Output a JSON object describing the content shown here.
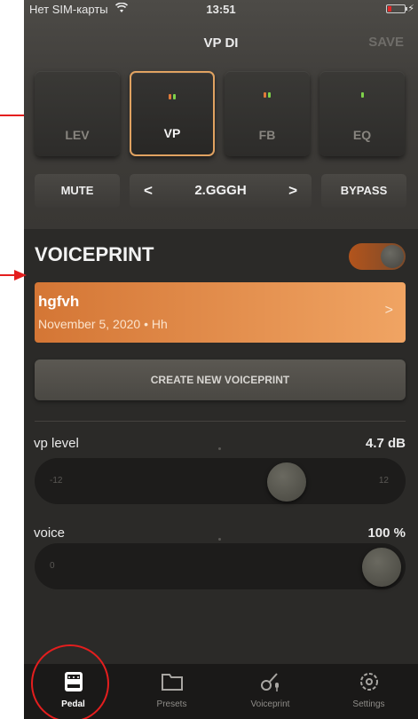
{
  "status_bar": {
    "carrier": "Нет SIM-карты",
    "time": "13:51",
    "wifi_icon": "wifi-icon",
    "battery_icon": "battery-low-icon",
    "charging_icon": "bolt-icon"
  },
  "nav": {
    "title": "VP DI",
    "save_label": "SAVE"
  },
  "blocks": [
    {
      "label": "LEV",
      "leds": [],
      "active": false
    },
    {
      "label": "VP",
      "leds": [
        "orange",
        "green"
      ],
      "active": true
    },
    {
      "label": "FB",
      "leds": [
        "orange",
        "green"
      ],
      "active": false
    },
    {
      "label": "EQ",
      "leds": [
        "green"
      ],
      "active": false
    }
  ],
  "controls": {
    "mute_label": "MUTE",
    "preset_name": "2.GGGH",
    "prev_icon": "chevron-left-icon",
    "next_icon": "chevron-right-icon",
    "bypass_label": "BYPASS"
  },
  "voiceprint": {
    "title": "VOICEPRINT",
    "toggle_on": true,
    "card": {
      "name": "hgfvh",
      "date": "November 5, 2020 • Hh"
    },
    "create_label": "CREATE NEW VOICEPRINT"
  },
  "params": [
    {
      "label": "vp level",
      "value": "4.7 dB",
      "min": "-12",
      "max": "12",
      "position": 0.705
    },
    {
      "label": "voice",
      "value": "100 %",
      "min": "0",
      "max": "",
      "position": 1.0
    }
  ],
  "tabs": [
    {
      "label": "Pedal",
      "icon": "pedal-icon",
      "active": true
    },
    {
      "label": "Presets",
      "icon": "folder-icon",
      "active": false
    },
    {
      "label": "Voiceprint",
      "icon": "guitar-mic-icon",
      "active": false
    },
    {
      "label": "Settings",
      "icon": "gear-icon",
      "active": false
    }
  ],
  "colors": {
    "accent_orange": "#e0a261",
    "card_gradient_start": "#d47635",
    "card_gradient_end": "#f0a463",
    "annotation_red": "#e41e1e"
  }
}
